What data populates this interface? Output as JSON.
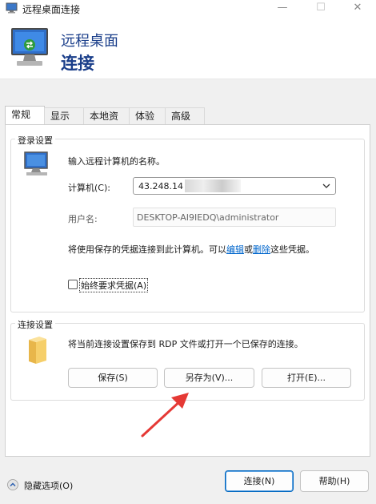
{
  "window": {
    "title": "远程桌面连接",
    "controls": {
      "minimize": "—",
      "maximize": "☐",
      "close": "✕"
    }
  },
  "header": {
    "line1": "远程桌面",
    "line2": "连接"
  },
  "tabs": [
    {
      "label": "常规",
      "active": true
    },
    {
      "label": "显示",
      "active": false
    },
    {
      "label": "本地资源",
      "active": false
    },
    {
      "label": "体验",
      "active": false
    },
    {
      "label": "高级",
      "active": false
    }
  ],
  "login": {
    "group_label": "登录设置",
    "instruction": "输入远程计算机的名称。",
    "computer_label": "计算机(C):",
    "computer_value": "43.248.14",
    "username_label": "用户名:",
    "username_value": "DESKTOP-AI9IEDQ\\administrator",
    "credentials_prefix": "将使用保存的凭据连接到此计算机。可以",
    "edit_link": "编辑",
    "or_text": "或",
    "delete_link": "删除",
    "credentials_suffix": "这些凭据。",
    "always_ask_label": "始终要求凭据(A)",
    "always_ask_checked": false
  },
  "connection": {
    "group_label": "连接设置",
    "description": "将当前连接设置保存到 RDP 文件或打开一个已保存的连接。",
    "save_button": "保存(S)",
    "save_as_button": "另存为(V)...",
    "open_button": "打开(E)..."
  },
  "footer": {
    "hide_options": "隐藏选项(O)",
    "connect_button": "连接(N)",
    "help_button": "帮助(H)"
  },
  "colors": {
    "accent": "#0067c0",
    "header_text": "#1a3e8a",
    "annotation_arrow": "#e53935"
  }
}
